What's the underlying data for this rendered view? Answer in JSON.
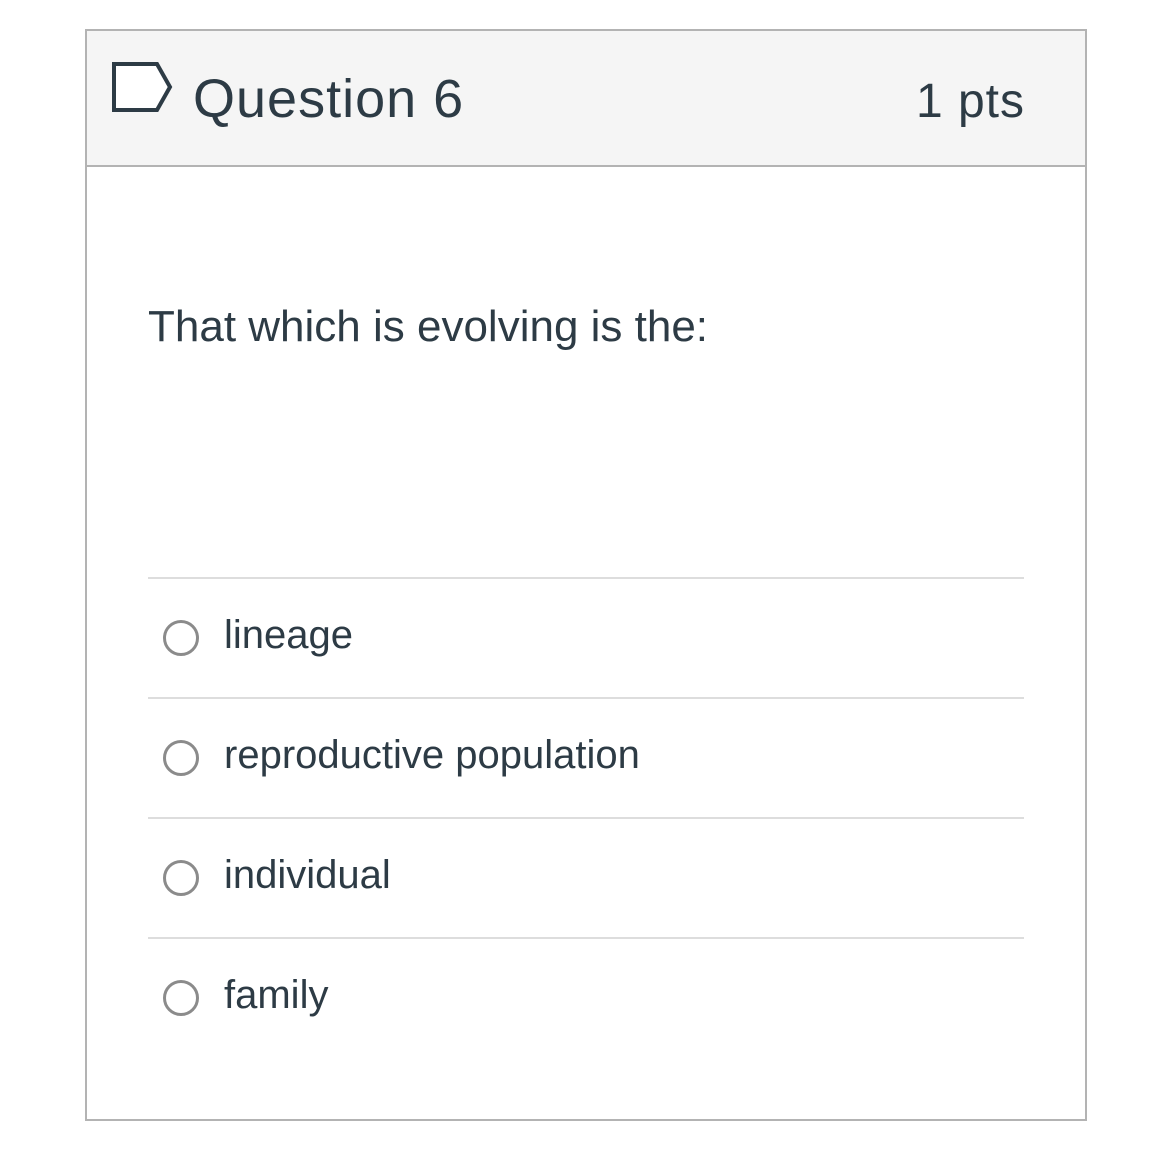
{
  "question": {
    "title": "Question 6",
    "points": "1 pts",
    "text": "That which is evolving is the:",
    "flag_icon": "flag-outline-icon",
    "answers": [
      {
        "label": "lineage",
        "selected": false
      },
      {
        "label": "reproductive population",
        "selected": false
      },
      {
        "label": "individual",
        "selected": false
      },
      {
        "label": "family",
        "selected": false
      }
    ]
  },
  "colors": {
    "text": "#2d3b45",
    "border": "#b3b3b3",
    "header_bg": "#f5f5f5",
    "divider": "#dddddd",
    "radio": "#8b8b8b"
  }
}
